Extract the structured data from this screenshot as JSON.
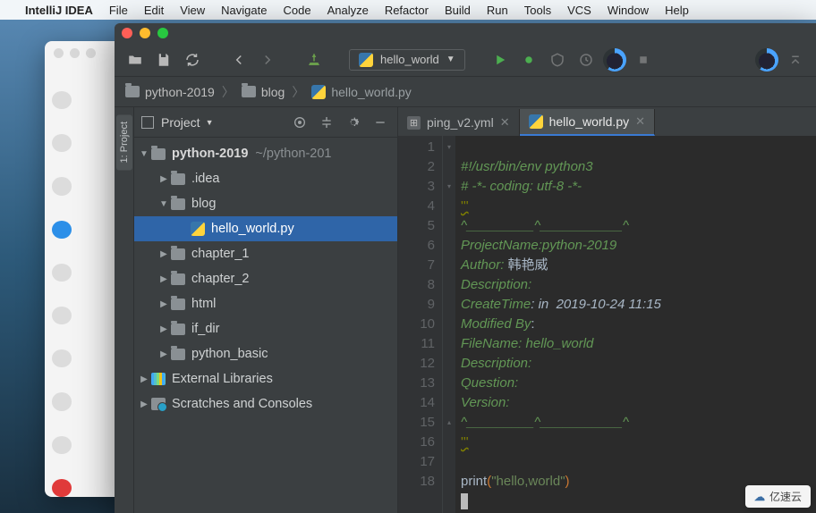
{
  "mac_menu": {
    "app_name": "IntelliJ IDEA",
    "items": [
      "File",
      "Edit",
      "View",
      "Navigate",
      "Code",
      "Analyze",
      "Refactor",
      "Build",
      "Run",
      "Tools",
      "VCS",
      "Window",
      "Help"
    ]
  },
  "toolbar": {
    "run_config": "hello_world"
  },
  "breadcrumb": {
    "root": "python-2019",
    "folder": "blog",
    "file": "hello_world.py"
  },
  "project_pane": {
    "title": "Project",
    "tool_label": "1: Project",
    "root": {
      "name": "python-2019",
      "path": "~/python-201"
    },
    "nodes": {
      "idea": ".idea",
      "blog": "blog",
      "file": "hello_world.py",
      "ch1": "chapter_1",
      "ch2": "chapter_2",
      "html": "html",
      "ifdir": "if_dir",
      "pybasic": "python_basic",
      "ext": "External Libraries",
      "scr": "Scratches and Consoles"
    }
  },
  "tabs": {
    "t1": "ping_v2.yml",
    "t2": "hello_world.py"
  },
  "code": {
    "lines": {
      "l1": "#!/usr/bin/env python3",
      "l2": "# -*- coding: utf-8 -*-",
      "l3": "'''",
      "l4": "^_________^___________^",
      "l5": "ProjectName:python-2019",
      "l6a": "Author:",
      "l6b": " 韩艳威",
      "l7": "Description:",
      "l8a": "CreateTime",
      "l8b": ": in  2019-10-24 11:15",
      "l9a": "Modified By",
      "l9b": ":",
      "l10": "FileName: hello_world",
      "l11": "Description:",
      "l12": "Question:",
      "l13": "Version:",
      "l14": "^_________^___________^",
      "l15": "'''",
      "l17_fn": "print",
      "l17_p1": "(",
      "l17_s": "\"hello,world\"",
      "l17_p2": ")"
    },
    "count": 18
  },
  "watermark": "亿速云"
}
